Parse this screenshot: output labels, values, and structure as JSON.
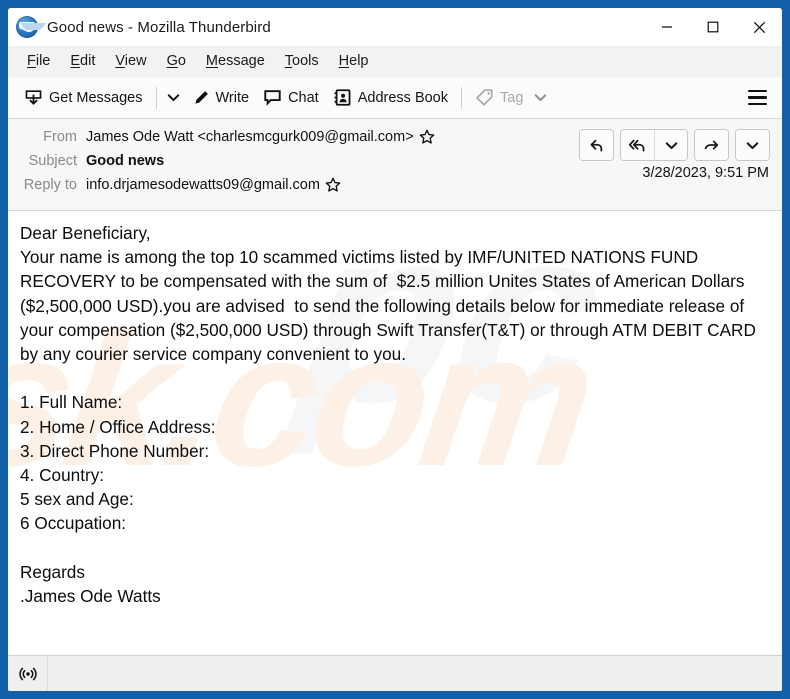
{
  "window": {
    "title": "Good news - Mozilla Thunderbird",
    "app_icon": "thunderbird-icon",
    "minimize_label": "Minimize",
    "maximize_label": "Maximize",
    "close_label": "Close",
    "frame_color": "#1260a8"
  },
  "menubar": {
    "items": [
      {
        "label": "File",
        "accel": "F"
      },
      {
        "label": "Edit",
        "accel": "E"
      },
      {
        "label": "View",
        "accel": "V"
      },
      {
        "label": "Go",
        "accel": "G"
      },
      {
        "label": "Message",
        "accel": "M"
      },
      {
        "label": "Tools",
        "accel": "T"
      },
      {
        "label": "Help",
        "accel": "H"
      }
    ]
  },
  "toolbar": {
    "get_messages_label": "Get Messages",
    "write_label": "Write",
    "chat_label": "Chat",
    "address_book_label": "Address Book",
    "tag_label": "Tag",
    "tag_disabled": true,
    "app_menu_label": "Application Menu"
  },
  "message_header": {
    "from_label": "From",
    "from_value": "James Ode Watt <charlesmcgurk009@gmail.com>",
    "subject_label": "Subject",
    "subject_value": "Good news",
    "reply_to_label": "Reply to",
    "reply_to_value": "info.drjamesodewatts09@gmail.com",
    "date": "3/28/2023, 9:51 PM",
    "actions": {
      "reply_label": "Reply",
      "reply_all_label": "Reply All",
      "reply_more_label": "More reply options",
      "forward_label": "Forward",
      "other_actions_label": "Other Actions"
    }
  },
  "message_body": {
    "text": "Dear Beneficiary,\nYour name is among the top 10 scammed victims listed by IMF/UNITED NATIONS FUND RECOVERY to be compensated with the sum of  $2.5 million Unites States of American Dollars ($2,500,000 USD).you are advised  to send the following details below for immediate release of your compensation ($2,500,000 USD) through Swift Transfer(T&T) or through ATM DEBIT CARD by any courier service company convenient to you.\n\n1. Full Name:\n2. Home / Office Address:\n3. Direct Phone Number:\n4. Country:\n5 sex and Age:\n6 Occupation:\n\nRegards\n.James Ode Watts",
    "watermark_front": "sk.com",
    "watermark_back": "pc"
  },
  "statusbar": {
    "connection_icon": "broadcast-icon",
    "status_text": ""
  },
  "colors": {
    "frame_blue": "#1260a8",
    "toolbar_bg": "#fbfbfb",
    "menubar_bg": "#f2f2f2",
    "header_bg": "#f7f7f7",
    "body_bg": "#ffffff",
    "status_bg": "#efefef",
    "label_gray": "#8a8a8a",
    "disabled_gray": "#a9a9a9"
  }
}
